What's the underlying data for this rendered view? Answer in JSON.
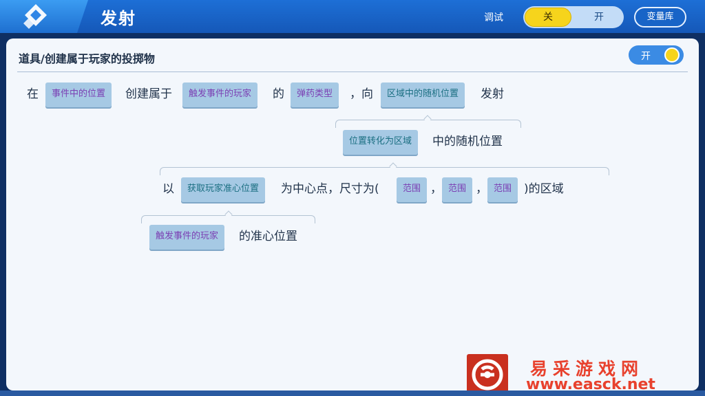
{
  "header": {
    "title": "发射",
    "debug_label": "调试",
    "debug_off": "关",
    "debug_on": "开",
    "variable_library": "变量库"
  },
  "panel": {
    "title": "道具/创建属于玩家的投掷物",
    "toggle_label": "开"
  },
  "row1": {
    "t1": "在",
    "chip1": "事件中的位置",
    "t2": "创建属于",
    "chip2": "触发事件的玩家",
    "t3": "的",
    "chip3": "弹药类型",
    "t4": "，向",
    "chip4": "区域中的随机位置",
    "t5": "发射"
  },
  "row2": {
    "chip": "位置转化为区域",
    "text": "中的随机位置"
  },
  "row3": {
    "t1": "以",
    "chip1": "获取玩家准心位置",
    "t2": "为中心点，尺寸为(",
    "chip2": "范围",
    "comma1": "，",
    "chip3": "范围",
    "comma2": "，",
    "chip4": "范围",
    "t3": ")的区域"
  },
  "row4": {
    "chip": "触发事件的玩家",
    "text": "的准心位置"
  },
  "watermark": {
    "name": "易采游戏网",
    "url": "www.easck.net"
  },
  "colors": {
    "header": "#1558b8",
    "accent_yellow": "#f6d41c",
    "chip_bg": "#a6c9e4",
    "chip_purple_text": "#7b3fb3",
    "chip_teal_text": "#1b6f82"
  },
  "icons": {
    "back": "back-diamond-icon",
    "watermark_logo": "easck-logo-icon"
  }
}
